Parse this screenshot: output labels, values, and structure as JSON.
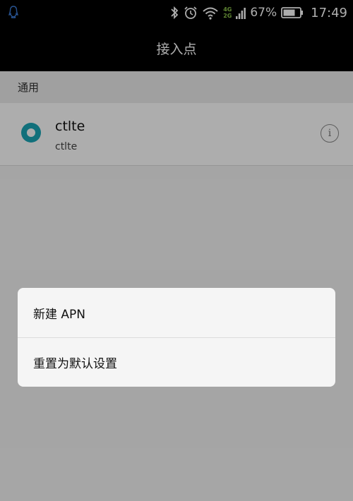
{
  "status_bar": {
    "left_icon": "qq-penguin-icon",
    "net_top": "4G",
    "net_bottom": "2G",
    "battery_percent": "67%",
    "time": "17:49"
  },
  "title_bar": {
    "title": "接入点"
  },
  "section": {
    "header": "通用"
  },
  "apn_list": [
    {
      "name": "ctlte",
      "subtitle": "ctlte",
      "selected": true
    }
  ],
  "menu": {
    "items": [
      {
        "label": "新建 APN"
      },
      {
        "label": "重置为默认设置"
      }
    ]
  },
  "colors": {
    "accent": "#1aa5b6",
    "status_bar_bg": "#000000",
    "net_label": "#8bc34a"
  }
}
